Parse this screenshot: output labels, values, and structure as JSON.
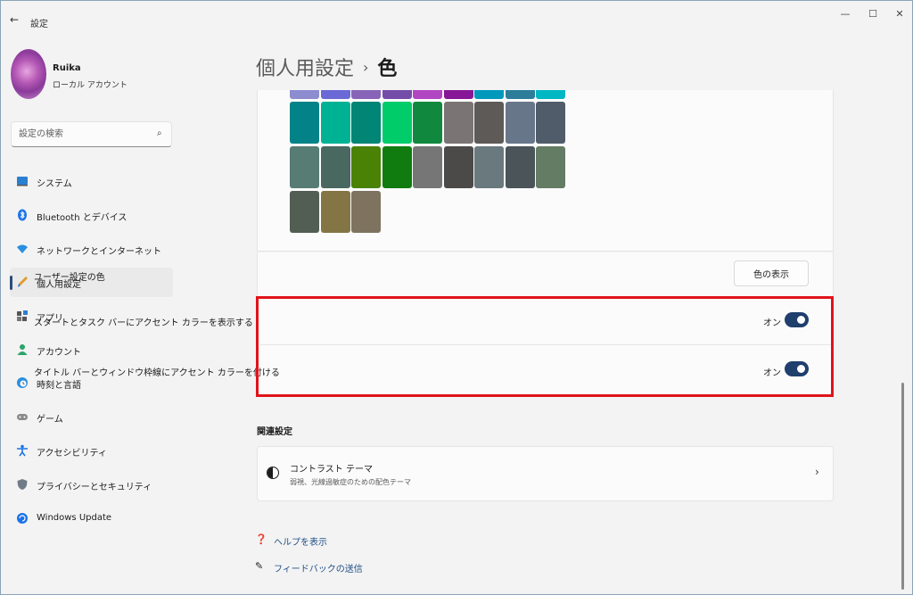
{
  "window": {
    "title": "設定"
  },
  "profile": {
    "name": "Ruika",
    "account_type": "ローカル アカウント"
  },
  "search": {
    "placeholder": "設定の検索"
  },
  "sidebar": {
    "items": [
      {
        "label": "システム",
        "icon": "monitor-icon"
      },
      {
        "label": "Bluetooth とデバイス",
        "icon": "bluetooth-icon"
      },
      {
        "label": "ネットワークとインターネット",
        "icon": "wifi-icon"
      },
      {
        "label": "個人用設定",
        "icon": "brush-icon",
        "active": true
      },
      {
        "label": "アプリ",
        "icon": "apps-icon"
      },
      {
        "label": "アカウント",
        "icon": "person-icon"
      },
      {
        "label": "時刻と言語",
        "icon": "clock-globe-icon"
      },
      {
        "label": "ゲーム",
        "icon": "gamepad-icon"
      },
      {
        "label": "アクセシビリティ",
        "icon": "accessibility-icon"
      },
      {
        "label": "プライバシーとセキュリティ",
        "icon": "shield-icon"
      },
      {
        "label": "Windows Update",
        "icon": "update-icon"
      }
    ]
  },
  "breadcrumb": {
    "parent": "個人用設定",
    "separator": "›",
    "current": "色"
  },
  "palette": {
    "partial_row": [
      "#8c8ccf",
      "#6b69d6",
      "#8764b8",
      "#744da9",
      "#b146c2",
      "#881798",
      "#0099bc",
      "#2d7d9a",
      "#00b7c3"
    ],
    "rows": [
      [
        "#038387",
        "#00b294",
        "#018574",
        "#00cc6a",
        "#10893e",
        "#7a7574",
        "#5d5a58",
        "#68768a",
        "#515c6b"
      ],
      [
        "#567c73",
        "#486860",
        "#498205",
        "#107c10",
        "#767676",
        "#4c4a48",
        "#69797e",
        "#4a5459",
        "#647c64"
      ],
      [
        "#525e54",
        "#847545",
        "#7e735f"
      ]
    ]
  },
  "custom_color": {
    "label": "ユーザー設定の色",
    "button_label": "色の表示"
  },
  "accent_start_taskbar": {
    "label": "スタートとタスク バーにアクセント カラーを表示する",
    "state": "オン",
    "on": true
  },
  "accent_title_bar": {
    "label": "タイトル バーとウィンドウ枠線にアクセント カラーを付ける",
    "state": "オン",
    "on": true
  },
  "related": {
    "title": "関連設定",
    "contrast_title": "コントラスト テーマ",
    "contrast_desc": "弱視、光線過敏症のための配色テーマ"
  },
  "footer": {
    "help": "ヘルプを表示",
    "feedback": "フィードバックの送信"
  },
  "colors": {
    "accent": "#1f3f6d",
    "highlight": "#e0141b",
    "link": "#1f4f86"
  }
}
